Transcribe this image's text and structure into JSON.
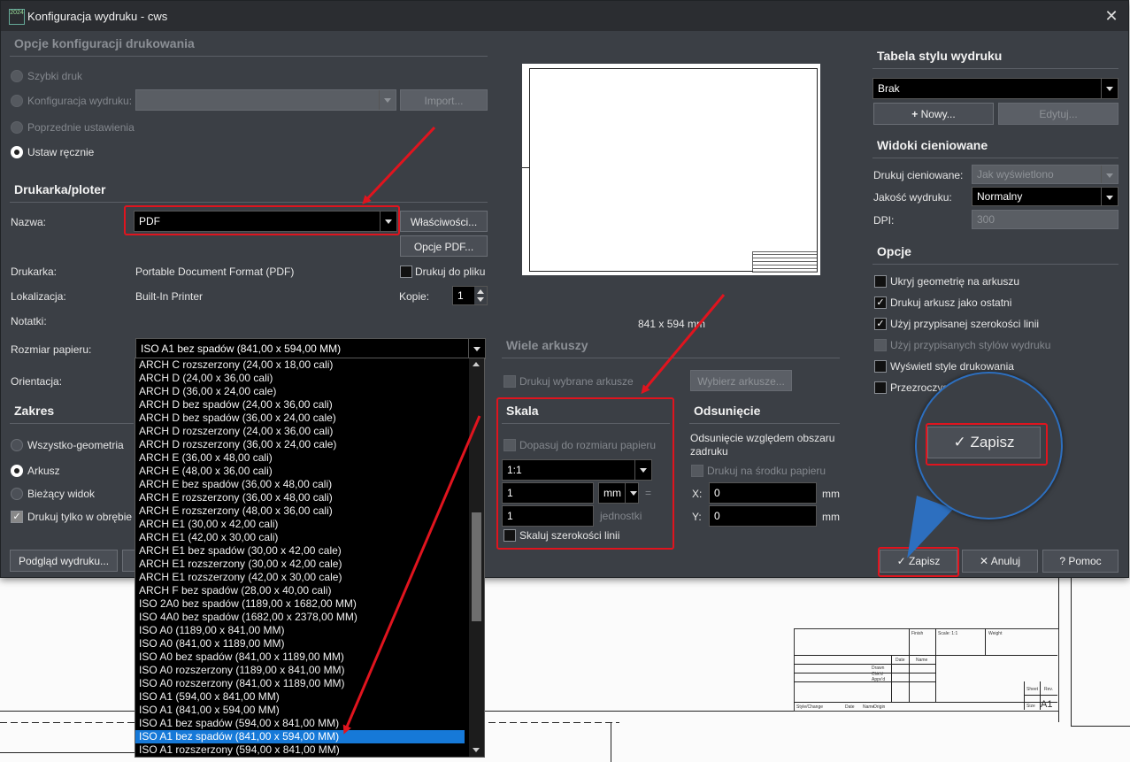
{
  "window": {
    "title": "Konfiguracja wydruku - cws",
    "icon_text": "2024"
  },
  "config_options": {
    "heading": "Opcje konfiguracji drukowania",
    "quick_print": "Szybki druk",
    "print_config": "Konfiguracja wydruku:",
    "import_button": "Import...",
    "previous_settings": "Poprzednie ustawienia",
    "manual": "Ustaw ręcznie"
  },
  "printer": {
    "heading": "Drukarka/ploter",
    "name_label": "Nazwa:",
    "name_value": "PDF",
    "properties_button": "Właściwości...",
    "pdf_options_button": "Opcje PDF...",
    "printer_label": "Drukarka:",
    "printer_value": "Portable Document Format (PDF)",
    "print_to_file": "Drukuj do pliku",
    "location_label": "Lokalizacja:",
    "location_value": "Built-In Printer",
    "copies_label": "Kopie:",
    "copies_value": "1",
    "notes_label": "Notatki:"
  },
  "paper": {
    "size_label": "Rozmiar papieru:",
    "size_value": "ISO A1 bez spadów (841,00 x 594,00 MM)",
    "orientation_label": "Orientacja:",
    "options": [
      "ARCH C rozszerzony (24,00 x 18,00 cali)",
      "ARCH D (24,00 x 36,00 cali)",
      "ARCH D (36,00 x 24,00 cale)",
      "ARCH D bez spadów (24,00 x 36,00 cali)",
      "ARCH D bez spadów (36,00 x 24,00 cale)",
      "ARCH D rozszerzony (24,00 x 36,00 cali)",
      "ARCH D rozszerzony (36,00 x 24,00 cale)",
      "ARCH E (36,00 x 48,00 cali)",
      "ARCH E (48,00 x 36,00 cali)",
      "ARCH E bez spadów (36,00 x 48,00 cali)",
      "ARCH E rozszerzony (36,00 x 48,00 cali)",
      "ARCH E rozszerzony (48,00 x 36,00 cali)",
      "ARCH E1 (30,00 x 42,00 cali)",
      "ARCH E1 (42,00 x 30,00 cali)",
      "ARCH E1 bez spadów (30,00 x 42,00 cale)",
      "ARCH E1 rozszerzony (30,00 x 42,00 cale)",
      "ARCH E1 rozszerzony (42,00 x 30,00 cale)",
      "ARCH F bez spadów (28,00 x 40,00 cali)",
      "ISO 2A0 bez spadów (1189,00 x 1682,00 MM)",
      "ISO 4A0 bez spadów (1682,00 x 2378,00 MM)",
      "ISO A0 (1189,00 x 841,00 MM)",
      "ISO A0 (841,00 x 1189,00 MM)",
      "ISO A0 bez spadów (841,00 x 1189,00 MM)",
      "ISO A0 rozszerzony (1189,00 x 841,00 MM)",
      "ISO A0 rozszerzony (841,00 x 1189,00 MM)",
      "ISO A1 (594,00 x 841,00 MM)",
      "ISO A1 (841,00 x 594,00 MM)",
      "ISO A1 bez spadów (594,00 x 841,00 MM)",
      "ISO A1 bez spadów (841,00 x 594,00 MM)",
      "ISO A1 rozszerzony (594,00 x 841,00 MM)"
    ],
    "selected_index": 28
  },
  "range": {
    "heading": "Zakres",
    "all_geometry": "Wszystko-geometria",
    "sheet": "Arkusz",
    "current_view": "Bieżący widok",
    "print_within": "Drukuj tylko w obrębie"
  },
  "preview": {
    "size_label": "841 x 594 mm",
    "preview_button": "Podgląd wydruku..."
  },
  "multi_sheet": {
    "heading": "Wiele arkuszy",
    "print_selected": "Drukuj wybrane arkusze",
    "select_button": "Wybierz arkusze..."
  },
  "scale": {
    "heading": "Skala",
    "fit_to_paper": "Dopasuj do rozmiaru papieru",
    "ratio": "1:1",
    "value1": "1",
    "unit": "mm",
    "equals": "=",
    "value2": "1",
    "units_label": "jednostki",
    "scale_lineweights": "Skaluj szerokości linii"
  },
  "offset": {
    "heading": "Odsunięcie",
    "description": "Odsunięcie względem obszaru zadruku",
    "center": "Drukuj na środku papieru",
    "x_label": "X:",
    "x_value": "0",
    "y_label": "Y:",
    "y_value": "0",
    "unit": "mm"
  },
  "style_table": {
    "heading": "Tabela stylu wydruku",
    "value": "Brak",
    "new_button": "Nowy...",
    "edit_button": "Edytuj..."
  },
  "shaded": {
    "heading": "Widoki cieniowane",
    "shade_label": "Drukuj cieniowane:",
    "shade_value": "Jak wyświetlono",
    "quality_label": "Jakość wydruku:",
    "quality_value": "Normalny",
    "dpi_label": "DPI:",
    "dpi_value": "300"
  },
  "options": {
    "heading": "Opcje",
    "items": [
      {
        "label": "Ukryj geometrię na arkuszu",
        "checked": false,
        "disabled": false
      },
      {
        "label": "Drukuj arkusz jako ostatni",
        "checked": true,
        "disabled": false
      },
      {
        "label": "Użyj przypisanej szerokości linii",
        "checked": true,
        "disabled": false
      },
      {
        "label": "Użyj przypisanych stylów wydruku",
        "checked": false,
        "disabled": true
      },
      {
        "label": "Wyświetl style drukowania",
        "checked": false,
        "disabled": false
      },
      {
        "label": "Przezroczys",
        "checked": false,
        "disabled": false
      }
    ]
  },
  "footer": {
    "save_button": "Zapisz",
    "cancel_button": "Anuluj",
    "help_button": "Pomoc"
  },
  "magnifier": {
    "save_button": "Zapisz"
  },
  "background": {
    "title_block": [
      "Finish",
      "Scale: 1:1",
      "Weight",
      "Date",
      "Name",
      "Drawn",
      "Chk'd",
      "Appv'd",
      "Sheet",
      "Rev.",
      "Size",
      "A1",
      "Style/Change",
      "Date",
      "Name",
      "Origin"
    ]
  },
  "colors": {
    "dialog_bg": "#3b3f45",
    "highlight": "#e0141e",
    "selection": "#1679d8",
    "magnifier_border": "#2d6fbf"
  }
}
